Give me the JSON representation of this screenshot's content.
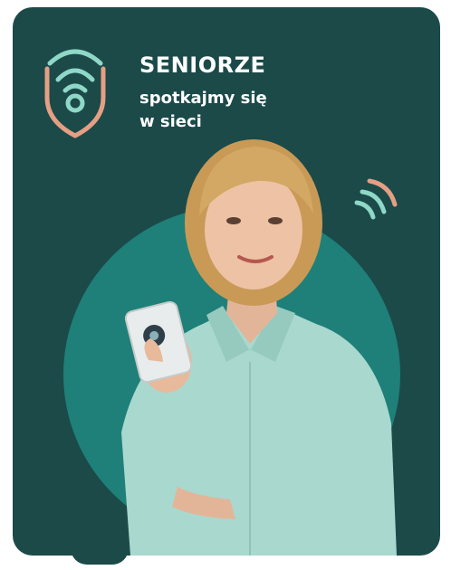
{
  "campaign": {
    "title": "SENIORZE",
    "subtitle_line1": "spotkajmy się",
    "subtitle_line2": "w sieci"
  },
  "colors": {
    "background": "#1b4a49",
    "circle": "#1e8078",
    "accent_orange": "#e69f84",
    "accent_mint": "#8fd8c8",
    "shirt": "#a9d8cf",
    "hair": "#c99a56"
  },
  "icons": [
    "shield-wifi-icon",
    "wifi-signal-icon",
    "smartphone-icon"
  ]
}
